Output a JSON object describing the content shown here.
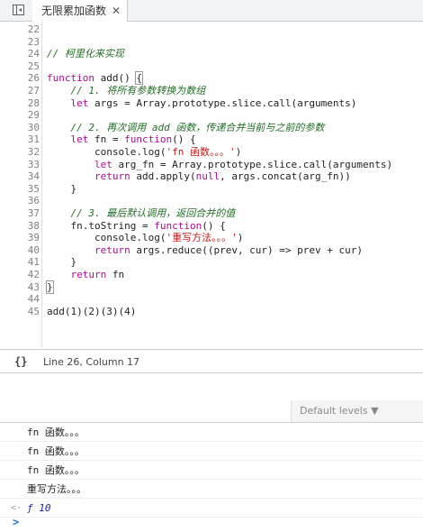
{
  "tab": {
    "title": "无限累加函数",
    "close_glyph": "✕"
  },
  "editor": {
    "lines": [
      {
        "n": "22",
        "segments": []
      },
      {
        "n": "23",
        "segments": []
      },
      {
        "n": "24",
        "segments": [
          {
            "t": "// 柯里化来实现",
            "c": "cm"
          }
        ]
      },
      {
        "n": "25",
        "segments": []
      },
      {
        "n": "26",
        "segments": [
          {
            "t": "function",
            "c": "kw"
          },
          {
            "t": " add() ",
            "c": ""
          },
          {
            "t": "{",
            "c": "hilite"
          },
          {
            "t": "",
            "c": "cursor"
          }
        ]
      },
      {
        "n": "27",
        "segments": [
          {
            "t": "    ",
            "c": ""
          },
          {
            "t": "// 1. 将所有参数转换为数组",
            "c": "cm"
          }
        ]
      },
      {
        "n": "28",
        "segments": [
          {
            "t": "    ",
            "c": ""
          },
          {
            "t": "let",
            "c": "kw"
          },
          {
            "t": " args = Array.prototype.slice.call(arguments)",
            "c": ""
          }
        ]
      },
      {
        "n": "29",
        "segments": []
      },
      {
        "n": "30",
        "segments": [
          {
            "t": "    ",
            "c": ""
          },
          {
            "t": "// 2. 再次调用 add 函数，传递合并当前与之前的参数",
            "c": "cm"
          }
        ]
      },
      {
        "n": "31",
        "segments": [
          {
            "t": "    ",
            "c": ""
          },
          {
            "t": "let",
            "c": "kw"
          },
          {
            "t": " fn = ",
            "c": ""
          },
          {
            "t": "function",
            "c": "kw"
          },
          {
            "t": "() {",
            "c": ""
          }
        ]
      },
      {
        "n": "32",
        "segments": [
          {
            "t": "        console.log(",
            "c": ""
          },
          {
            "t": "'fn 函数。。。'",
            "c": "str"
          },
          {
            "t": ")",
            "c": ""
          }
        ]
      },
      {
        "n": "33",
        "segments": [
          {
            "t": "        ",
            "c": ""
          },
          {
            "t": "let",
            "c": "kw"
          },
          {
            "t": " arg_fn = Array.prototype.slice.call(arguments)",
            "c": ""
          }
        ]
      },
      {
        "n": "34",
        "segments": [
          {
            "t": "        ",
            "c": ""
          },
          {
            "t": "return",
            "c": "kw"
          },
          {
            "t": " add.apply(",
            "c": ""
          },
          {
            "t": "null",
            "c": "kw"
          },
          {
            "t": ", args.concat(arg_fn))",
            "c": ""
          }
        ]
      },
      {
        "n": "35",
        "segments": [
          {
            "t": "    }",
            "c": ""
          }
        ]
      },
      {
        "n": "36",
        "segments": []
      },
      {
        "n": "37",
        "segments": [
          {
            "t": "    ",
            "c": ""
          },
          {
            "t": "// 3. 最后默认调用，返回合并的值",
            "c": "cm"
          }
        ]
      },
      {
        "n": "38",
        "segments": [
          {
            "t": "    fn.toString = ",
            "c": ""
          },
          {
            "t": "function",
            "c": "kw"
          },
          {
            "t": "() {",
            "c": ""
          }
        ]
      },
      {
        "n": "39",
        "segments": [
          {
            "t": "        console.log(",
            "c": ""
          },
          {
            "t": "'重写方法。。。'",
            "c": "str"
          },
          {
            "t": ")",
            "c": ""
          }
        ]
      },
      {
        "n": "40",
        "segments": [
          {
            "t": "        ",
            "c": ""
          },
          {
            "t": "return",
            "c": "kw"
          },
          {
            "t": " args.reduce((prev, cur) => prev + cur)",
            "c": ""
          }
        ]
      },
      {
        "n": "41",
        "segments": [
          {
            "t": "    }",
            "c": ""
          }
        ]
      },
      {
        "n": "42",
        "segments": [
          {
            "t": "    ",
            "c": ""
          },
          {
            "t": "return",
            "c": "kw"
          },
          {
            "t": " fn",
            "c": ""
          }
        ]
      },
      {
        "n": "43",
        "segments": [
          {
            "t": "}",
            "c": "hilite"
          }
        ]
      },
      {
        "n": "44",
        "segments": []
      },
      {
        "n": "45",
        "segments": [
          {
            "t": "add(",
            "c": ""
          },
          {
            "t": "1",
            "c": ""
          },
          {
            "t": ")(",
            "c": ""
          },
          {
            "t": "2",
            "c": ""
          },
          {
            "t": ")(",
            "c": ""
          },
          {
            "t": "3",
            "c": ""
          },
          {
            "t": ")(",
            "c": ""
          },
          {
            "t": "4",
            "c": ""
          },
          {
            "t": ")",
            "c": ""
          }
        ]
      }
    ]
  },
  "status": {
    "braces_glyph": "{}",
    "position": "Line 26, Column 17"
  },
  "console": {
    "levels_label": "Default levels ▼",
    "messages": [
      "fn 函数。。。",
      "fn 函数。。。",
      "fn 函数。。。",
      "重写方法。。。"
    ],
    "return_marker": "<·",
    "return_value": "ƒ 10",
    "prompt_glyph": ">"
  }
}
